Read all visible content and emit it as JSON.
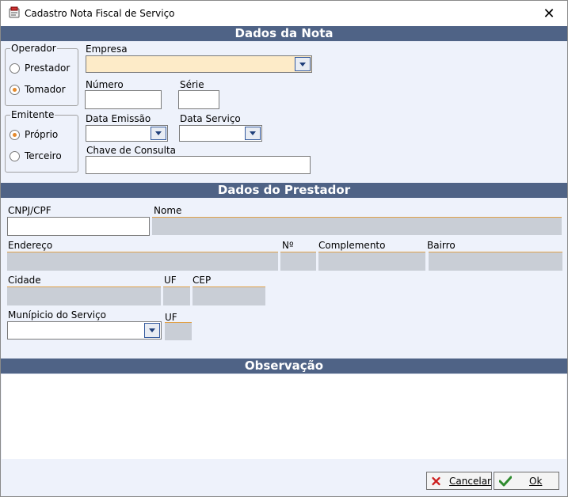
{
  "window": {
    "title": "Cadastro Nota Fiscal de Serviço",
    "close_glyph": "✕"
  },
  "sections": {
    "dados_nota": "Dados da Nota",
    "dados_prestador": "Dados do Prestador",
    "observacao": "Observação"
  },
  "operador": {
    "legend": "Operador",
    "options": [
      {
        "label": "Prestador",
        "checked": false
      },
      {
        "label": "Tomador",
        "checked": true
      }
    ]
  },
  "emitente": {
    "legend": "Emitente",
    "options": [
      {
        "label": "Próprio",
        "checked": true
      },
      {
        "label": "Terceiro",
        "checked": false
      }
    ]
  },
  "nota_fields": {
    "empresa_label": "Empresa",
    "empresa_value": "",
    "numero_label": "Número",
    "numero_value": "",
    "serie_label": "Série",
    "serie_value": "",
    "data_emissao_label": "Data Emissão",
    "data_emissao_value": "",
    "data_servico_label": "Data Serviço",
    "data_servico_value": "",
    "chave_label": "Chave de Consulta",
    "chave_value": ""
  },
  "prestador_fields": {
    "cnpj_label": "CNPJ/CPF",
    "nome_label": "Nome",
    "endereco_label": "Endereço",
    "numero_label": "Nº",
    "complemento_label": "Complemento",
    "bairro_label": "Bairro",
    "cidade_label": "Cidade",
    "uf_label": "UF",
    "cep_label": "CEP",
    "municipio_label": "Munípicio do Serviço",
    "municipio_uf_label": "UF"
  },
  "footer": {
    "cancel_label": "Cancelar",
    "ok_label": "Ok"
  },
  "colors": {
    "section_header": "#4f6386",
    "highlight_field": "#fdebc8",
    "readonly_field": "#c9ced6",
    "cancel_icon": "#cc1f1f",
    "ok_icon": "#2e8b2e"
  },
  "icons": {
    "app": "app-icon",
    "close": "close-icon",
    "cancel": "x-icon",
    "ok": "check-icon"
  }
}
